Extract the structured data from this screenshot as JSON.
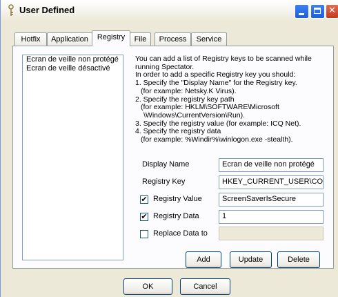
{
  "window": {
    "title": "User Defined"
  },
  "tabs": [
    {
      "label": "Hotfix"
    },
    {
      "label": "Application"
    },
    {
      "label": "Registry"
    },
    {
      "label": "File"
    },
    {
      "label": "Process"
    },
    {
      "label": "Service"
    }
  ],
  "active_tab": "Registry",
  "list": {
    "items": [
      {
        "label": "Ecran de veille non protégé"
      },
      {
        "label": "Ecran de veille désactivé"
      }
    ]
  },
  "description": [
    "You can add a list of Registry keys to be scanned while",
    "running Spectator.",
    "In order to add a specific Registry key you should:",
    "1. Specify the \"Display Name\" for the Registry key.",
    "    (for example: Netsky.K Virus).",
    "2. Specify the registry key path",
    "    (for example: HKLM\\SOFTWARE\\Microsoft",
    "     \\Windows\\CurrentVersion\\Run).",
    "3. Specify the registry value (for example: ICQ Net).",
    "4. Specify the registry data",
    "    (for example: %Windir%\\winlogon.exe -stealth)."
  ],
  "form": {
    "display_name_label": "Display Name",
    "display_name_value": "Ecran de veille non protégé",
    "registry_key_label": "Registry Key",
    "registry_key_value": "HKEY_CURRENT_USER\\CO",
    "registry_value_label": "Registry Value",
    "registry_value_checked": true,
    "registry_value_value": "ScreenSaverIsSecure",
    "registry_data_label": "Registry Data",
    "registry_data_checked": true,
    "registry_data_value": "1",
    "replace_label": "Replace Data to",
    "replace_checked": false,
    "replace_value": ""
  },
  "actions": {
    "add": "Add",
    "update": "Update",
    "delete": "Delete"
  },
  "footer": {
    "ok": "OK",
    "cancel": "Cancel"
  },
  "checkmark": "✔"
}
